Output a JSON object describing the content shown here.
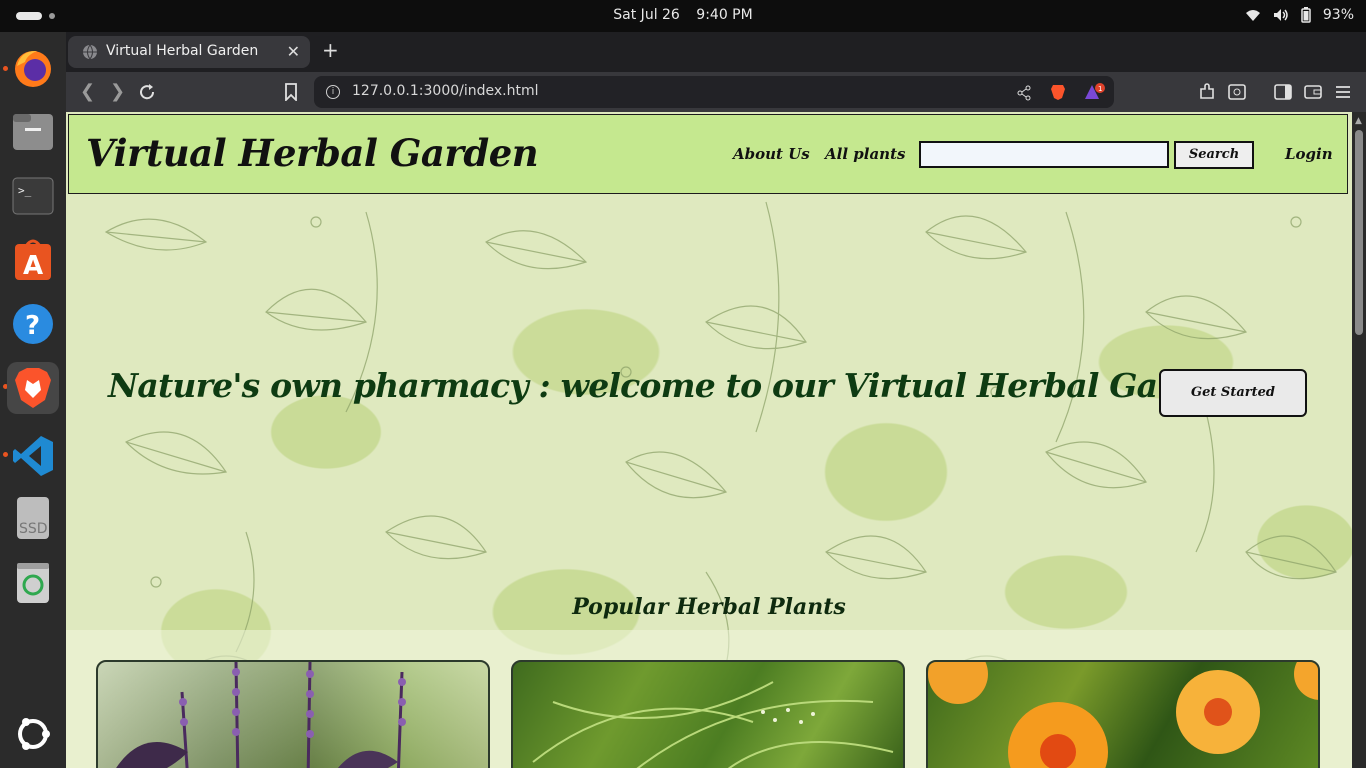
{
  "system": {
    "date": "Sat Jul 26",
    "time": "9:40 PM",
    "battery": "93%"
  },
  "dock": {
    "items": [
      "firefox-icon",
      "files-icon",
      "terminal-icon",
      "app-center-icon",
      "help-icon",
      "brave-icon",
      "vscode-icon",
      "ssd-drive-icon",
      "trash-icon",
      "ubuntu-apps-icon"
    ],
    "ssd_label": "SSD"
  },
  "browser": {
    "tab_title": "Virtual Herbal Garden",
    "new_tab": "+",
    "url": "127.0.0.1:3000/index.html",
    "notification_count": "1"
  },
  "site": {
    "title": "Virtual Herbal Garden",
    "nav": {
      "about": "About Us",
      "plants": "All plants",
      "search_button": "Search",
      "login": "Login"
    },
    "search_value": "",
    "hero": {
      "heading": "Nature's own pharmacy : welcome to our Virtual Herbal Garden",
      "cta": "Get Started"
    },
    "popular_heading": "Popular Herbal Plants"
  },
  "colors": {
    "header_bg": "#c5e88f",
    "page_bg": "#dfe9bf",
    "heading_green": "#0e3b12"
  }
}
